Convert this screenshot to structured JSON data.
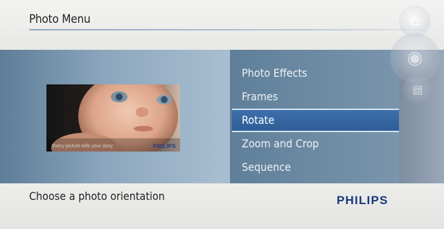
{
  "header": {
    "title": "Photo Menu"
  },
  "thumbnail": {
    "caption": "Every picture tells your story",
    "brand": "PHILIPS"
  },
  "menu": {
    "items": [
      {
        "label": "Photo Effects",
        "selected": false
      },
      {
        "label": "Frames",
        "selected": false
      },
      {
        "label": "Rotate",
        "selected": true
      },
      {
        "label": "Zoom and Crop",
        "selected": false
      },
      {
        "label": "Sequence",
        "selected": false
      }
    ]
  },
  "side_icons": [
    "photo-icon",
    "navigate-icon",
    "menu-icon"
  ],
  "footer": {
    "hint": "Choose a  photo orientation",
    "brand": "PHILIPS"
  },
  "colors": {
    "selected_bg": "#336399",
    "brand": "#17387a",
    "band": "#7f98ad"
  }
}
